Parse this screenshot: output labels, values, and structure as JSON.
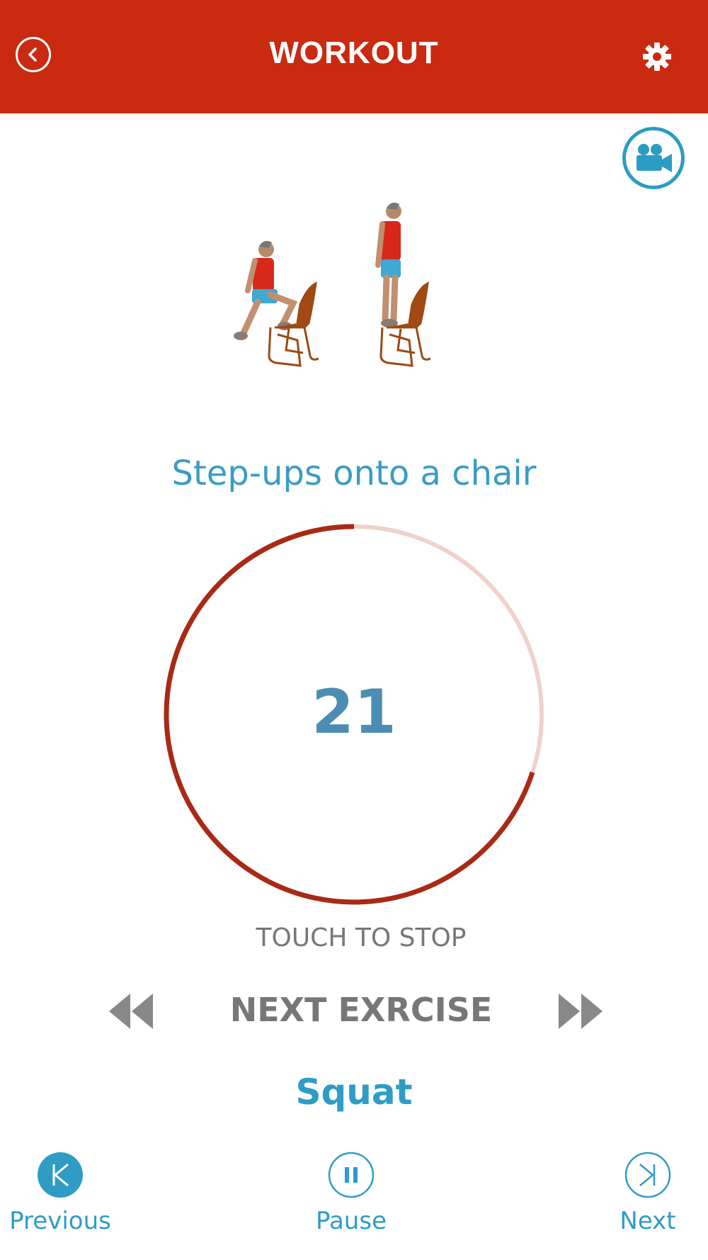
{
  "header": {
    "title": "WORKOUT",
    "back_icon": "chevron-left-icon",
    "settings_icon": "gear-icon",
    "background_color": "#c92a10"
  },
  "video_button": {
    "icon": "video-camera-icon",
    "color": "#2b9cc3"
  },
  "exercise": {
    "name": "Step-ups onto a chair",
    "illustration": "man-stepping-onto-chair"
  },
  "timer": {
    "count": "21",
    "progress_fraction": 0.7,
    "ring_color": "#a82a15",
    "track_color": "#efd2ca"
  },
  "controls": {
    "touch_label": "TOUCH TO STOP",
    "next_exercise_label": "NEXT EXRCISE",
    "next_exercise_name": "Squat",
    "rewind_icon": "rewind-icon",
    "fast_forward_icon": "fast-forward-icon"
  },
  "bottom_nav": {
    "previous": {
      "label": "Previous",
      "icon": "skip-previous-icon"
    },
    "pause": {
      "label": "Pause",
      "icon": "pause-icon"
    },
    "next": {
      "label": "Next",
      "icon": "skip-next-icon"
    }
  }
}
